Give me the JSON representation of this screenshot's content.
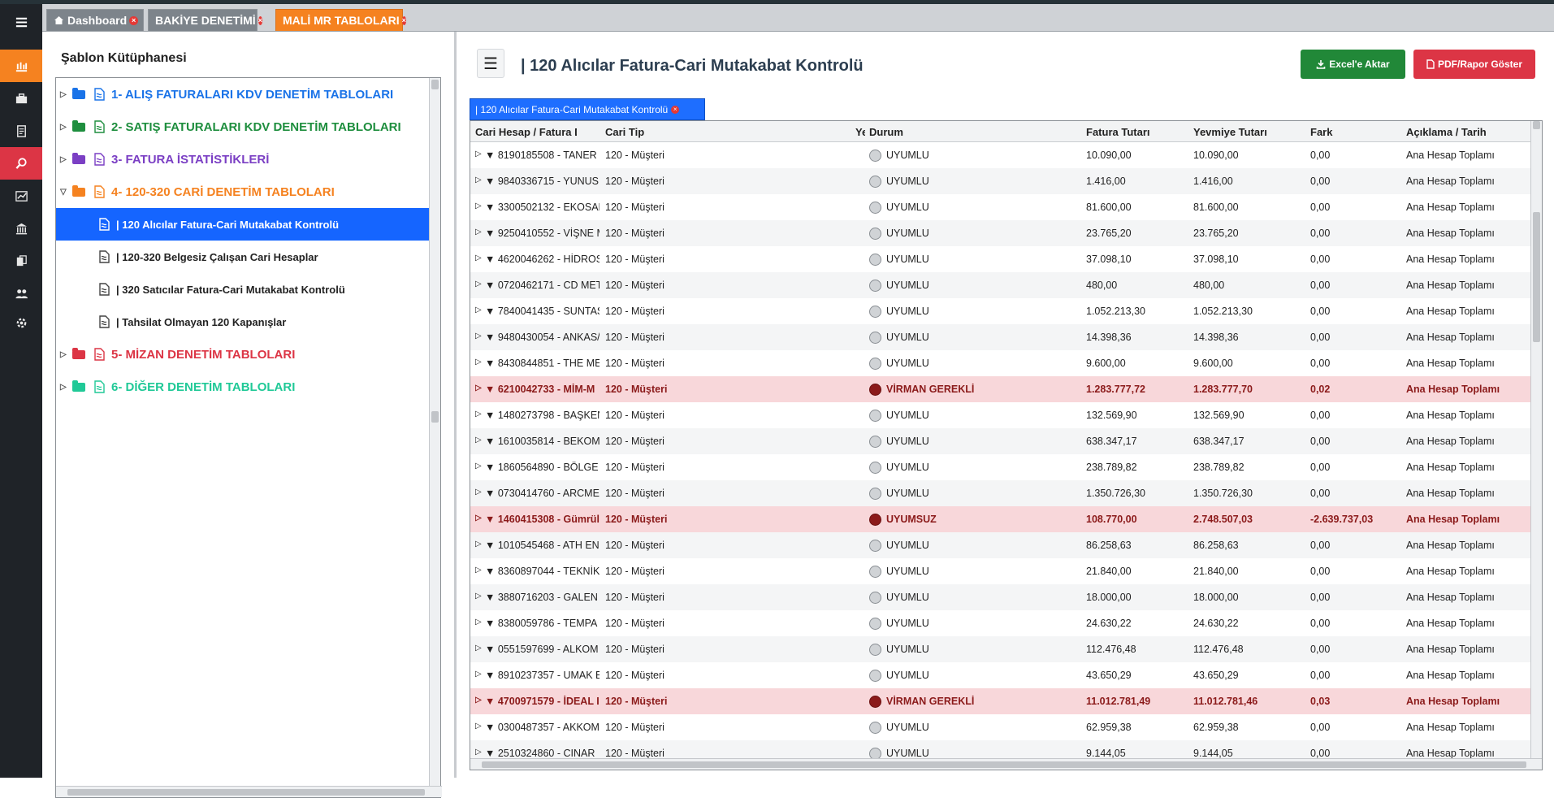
{
  "nav": {
    "items": [
      {
        "name": "menu-icon"
      },
      {
        "name": "dashboard-icon"
      },
      {
        "name": "briefcase-icon"
      },
      {
        "name": "ledger-icon"
      },
      {
        "name": "search-icon"
      },
      {
        "name": "chart-icon"
      },
      {
        "name": "bank-icon"
      },
      {
        "name": "documents-icon"
      },
      {
        "name": "users-icon"
      },
      {
        "name": "settings-icon"
      }
    ],
    "active_index": 1,
    "search_index": 4
  },
  "tabs": [
    {
      "label": "Dashboard",
      "icon": "home-icon",
      "active": false
    },
    {
      "label": "BAKİYE DENETİMİ",
      "active": false
    },
    {
      "label": "MALİ MR TABLOLARI",
      "active": true
    }
  ],
  "sidebar": {
    "title": "Şablon Kütüphanesi",
    "groups": [
      {
        "label": "1- ALIŞ FATURALARI KDV DENETİM TABLOLARI",
        "color": "#1a73e8",
        "expanded": false
      },
      {
        "label": "2- SATIŞ FATURALARI KDV DENETİM TABLOLARI",
        "color": "#1e8e3e",
        "expanded": false
      },
      {
        "label": "3- FATURA İSTATİSTİKLERİ",
        "color": "#7b3fc4",
        "expanded": false
      },
      {
        "label": "4- 120-320 CARİ DENETİM TABLOLARI",
        "color": "#f58220",
        "expanded": true,
        "children": [
          {
            "label": "| 120 Alıcılar Fatura-Cari Mutakabat Kontrolü",
            "selected": true
          },
          {
            "label": "| 120-320 Belgesiz Çalışan Cari Hesaplar",
            "selected": false
          },
          {
            "label": "| 320 Satıcılar Fatura-Cari Mutakabat Kontrolü",
            "selected": false
          },
          {
            "label": "| Tahsilat Olmayan 120 Kapanışlar",
            "selected": false
          }
        ]
      },
      {
        "label": "5- MİZAN DENETİM TABLOLARI",
        "color": "#dc3545",
        "expanded": false
      },
      {
        "label": "6- DİĞER DENETİM TABLOLARI",
        "color": "#20c997",
        "expanded": false
      }
    ]
  },
  "main": {
    "title": "| 120 Alıcılar Fatura-Cari Mutakabat Kontrolü",
    "excel_label": "Excel'e Aktar",
    "pdf_label": "PDF/Rapor Göster",
    "subtab_label": "| 120 Alıcılar Fatura-Cari Mutakabat Kontrolü",
    "columns": [
      "Cari Hesap / Fatura Detay",
      "Cari Tip",
      "Ye",
      "Durum",
      "Fatura Tutarı",
      "Yevmiye Tutarı",
      "Fark",
      "Açıklama / Tarih"
    ],
    "rows": [
      {
        "cari": "▼ 8190185508 - TANER",
        "tip": "120 - Müşteri",
        "durum": "UYUMLU",
        "fatura": "10.090,00",
        "yevmiye": "10.090,00",
        "fark": "0,00",
        "aciklama": "Ana Hesap Toplamı",
        "err": false
      },
      {
        "cari": "▼ 9840336715 - YUNUS",
        "tip": "120 - Müşteri",
        "durum": "UYUMLU",
        "fatura": "1.416,00",
        "yevmiye": "1.416,00",
        "fark": "0,00",
        "aciklama": "Ana Hesap Toplamı",
        "err": false
      },
      {
        "cari": "▼ 3300502132 - EKOSAN",
        "tip": "120 - Müşteri",
        "durum": "UYUMLU",
        "fatura": "81.600,00",
        "yevmiye": "81.600,00",
        "fark": "0,00",
        "aciklama": "Ana Hesap Toplamı",
        "err": false
      },
      {
        "cari": "▼ 9250410552 - VİŞNE M",
        "tip": "120 - Müşteri",
        "durum": "UYUMLU",
        "fatura": "23.765,20",
        "yevmiye": "23.765,20",
        "fark": "0,00",
        "aciklama": "Ana Hesap Toplamı",
        "err": false
      },
      {
        "cari": "▼ 4620046262 - HİDROS",
        "tip": "120 - Müşteri",
        "durum": "UYUMLU",
        "fatura": "37.098,10",
        "yevmiye": "37.098,10",
        "fark": "0,00",
        "aciklama": "Ana Hesap Toplamı",
        "err": false
      },
      {
        "cari": "▼ 0720462171 - CD MET",
        "tip": "120 - Müşteri",
        "durum": "UYUMLU",
        "fatura": "480,00",
        "yevmiye": "480,00",
        "fark": "0,00",
        "aciklama": "Ana Hesap Toplamı",
        "err": false
      },
      {
        "cari": "▼ 7840041435 - SUNTAŞ",
        "tip": "120 - Müşteri",
        "durum": "UYUMLU",
        "fatura": "1.052.213,30",
        "yevmiye": "1.052.213,30",
        "fark": "0,00",
        "aciklama": "Ana Hesap Toplamı",
        "err": false
      },
      {
        "cari": "▼ 9480430054 - ANKAS/",
        "tip": "120 - Müşteri",
        "durum": "UYUMLU",
        "fatura": "14.398,36",
        "yevmiye": "14.398,36",
        "fark": "0,00",
        "aciklama": "Ana Hesap Toplamı",
        "err": false
      },
      {
        "cari": "▼ 8430844851 - THE ME",
        "tip": "120 - Müşteri",
        "durum": "UYUMLU",
        "fatura": "9.600,00",
        "yevmiye": "9.600,00",
        "fark": "0,00",
        "aciklama": "Ana Hesap Toplamı",
        "err": false
      },
      {
        "cari": "▼ 6210042733 - MİM-M",
        "tip": "120 - Müşteri",
        "durum": "VİRMAN GEREKLİ",
        "fatura": "1.283.777,72",
        "yevmiye": "1.283.777,70",
        "fark": "0,02",
        "aciklama": "Ana Hesap Toplamı",
        "err": true
      },
      {
        "cari": "▼ 1480273798 - BAŞKEN",
        "tip": "120 - Müşteri",
        "durum": "UYUMLU",
        "fatura": "132.569,90",
        "yevmiye": "132.569,90",
        "fark": "0,00",
        "aciklama": "Ana Hesap Toplamı",
        "err": false
      },
      {
        "cari": "▼ 1610035814 - BEKOM",
        "tip": "120 - Müşteri",
        "durum": "UYUMLU",
        "fatura": "638.347,17",
        "yevmiye": "638.347,17",
        "fark": "0,00",
        "aciklama": "Ana Hesap Toplamı",
        "err": false
      },
      {
        "cari": "▼ 1860564890 - BÖLGE I",
        "tip": "120 - Müşteri",
        "durum": "UYUMLU",
        "fatura": "238.789,82",
        "yevmiye": "238.789,82",
        "fark": "0,00",
        "aciklama": "Ana Hesap Toplamı",
        "err": false
      },
      {
        "cari": "▼ 0730414760 - ARCMEI",
        "tip": "120 - Müşteri",
        "durum": "UYUMLU",
        "fatura": "1.350.726,30",
        "yevmiye": "1.350.726,30",
        "fark": "0,00",
        "aciklama": "Ana Hesap Toplamı",
        "err": false
      },
      {
        "cari": "▼ 1460415308 - Gümrül",
        "tip": "120 - Müşteri",
        "durum": "UYUMSUZ",
        "fatura": "108.770,00",
        "yevmiye": "2.748.507,03",
        "fark": "-2.639.737,03",
        "aciklama": "Ana Hesap Toplamı",
        "err": true
      },
      {
        "cari": "▼ 1010545468 - ATH EN",
        "tip": "120 - Müşteri",
        "durum": "UYUMLU",
        "fatura": "86.258,63",
        "yevmiye": "86.258,63",
        "fark": "0,00",
        "aciklama": "Ana Hesap Toplamı",
        "err": false
      },
      {
        "cari": "▼ 8360897044 - TEKNİK",
        "tip": "120 - Müşteri",
        "durum": "UYUMLU",
        "fatura": "21.840,00",
        "yevmiye": "21.840,00",
        "fark": "0,00",
        "aciklama": "Ana Hesap Toplamı",
        "err": false
      },
      {
        "cari": "▼ 3880716203 - GALEN",
        "tip": "120 - Müşteri",
        "durum": "UYUMLU",
        "fatura": "18.000,00",
        "yevmiye": "18.000,00",
        "fark": "0,00",
        "aciklama": "Ana Hesap Toplamı",
        "err": false
      },
      {
        "cari": "▼ 8380059786 - TEMPA",
        "tip": "120 - Müşteri",
        "durum": "UYUMLU",
        "fatura": "24.630,22",
        "yevmiye": "24.630,22",
        "fark": "0,00",
        "aciklama": "Ana Hesap Toplamı",
        "err": false
      },
      {
        "cari": "▼ 0551597699 - ALKOM",
        "tip": "120 - Müşteri",
        "durum": "UYUMLU",
        "fatura": "112.476,48",
        "yevmiye": "112.476,48",
        "fark": "0,00",
        "aciklama": "Ana Hesap Toplamı",
        "err": false
      },
      {
        "cari": "▼ 8910237357 - UMAK E",
        "tip": "120 - Müşteri",
        "durum": "UYUMLU",
        "fatura": "43.650,29",
        "yevmiye": "43.650,29",
        "fark": "0,00",
        "aciklama": "Ana Hesap Toplamı",
        "err": false
      },
      {
        "cari": "▼ 4700971579 - İDEAL I",
        "tip": "120 - Müşteri",
        "durum": "VİRMAN GEREKLİ",
        "fatura": "11.012.781,49",
        "yevmiye": "11.012.781,46",
        "fark": "0,03",
        "aciklama": "Ana Hesap Toplamı",
        "err": true
      },
      {
        "cari": "▼ 0300487357 - AKKOM",
        "tip": "120 - Müşteri",
        "durum": "UYUMLU",
        "fatura": "62.959,38",
        "yevmiye": "62.959,38",
        "fark": "0,00",
        "aciklama": "Ana Hesap Toplamı",
        "err": false
      },
      {
        "cari": "▼ 2510324860 - CINAR",
        "tip": "120 - Müşteri",
        "durum": "UYUMLU",
        "fatura": "9.144,05",
        "yevmiye": "9.144,05",
        "fark": "0,00",
        "aciklama": "Ana Hesap Toplamı",
        "err": false
      }
    ]
  },
  "colors": {
    "accent": "#f58220",
    "selected": "#1565ff",
    "error_row": "#f8d7da",
    "error_text": "#8b1a1a",
    "excel": "#218838",
    "pdf": "#dc3545"
  }
}
